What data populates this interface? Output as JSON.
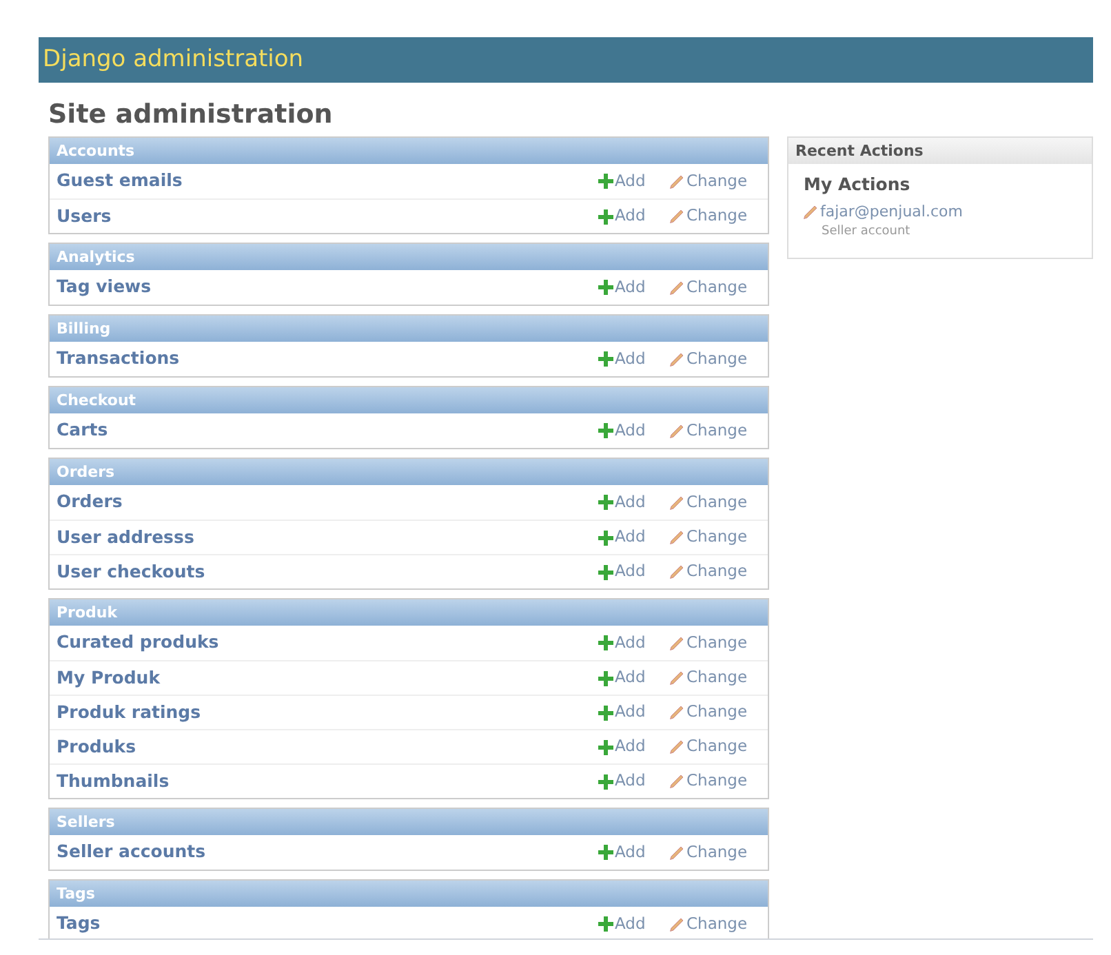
{
  "header": {
    "title": "Django administration"
  },
  "heading": "Site administration",
  "modules": [
    {
      "caption": "Accounts",
      "models": [
        {
          "name": "Guest emails",
          "add": "Add",
          "change": "Change"
        },
        {
          "name": "Users",
          "add": "Add",
          "change": "Change"
        }
      ]
    },
    {
      "caption": "Analytics",
      "models": [
        {
          "name": "Tag views",
          "add": "Add",
          "change": "Change"
        }
      ]
    },
    {
      "caption": "Billing",
      "models": [
        {
          "name": "Transactions",
          "add": "Add",
          "change": "Change"
        }
      ]
    },
    {
      "caption": "Checkout",
      "models": [
        {
          "name": "Carts",
          "add": "Add",
          "change": "Change"
        }
      ]
    },
    {
      "caption": "Orders",
      "models": [
        {
          "name": "Orders",
          "add": "Add",
          "change": "Change"
        },
        {
          "name": "User addresss",
          "add": "Add",
          "change": "Change"
        },
        {
          "name": "User checkouts",
          "add": "Add",
          "change": "Change"
        }
      ]
    },
    {
      "caption": "Produk",
      "models": [
        {
          "name": "Curated produks",
          "add": "Add",
          "change": "Change"
        },
        {
          "name": "My Produk",
          "add": "Add",
          "change": "Change"
        },
        {
          "name": "Produk ratings",
          "add": "Add",
          "change": "Change"
        },
        {
          "name": "Produks",
          "add": "Add",
          "change": "Change"
        },
        {
          "name": "Thumbnails",
          "add": "Add",
          "change": "Change"
        }
      ]
    },
    {
      "caption": "Sellers",
      "models": [
        {
          "name": "Seller accounts",
          "add": "Add",
          "change": "Change"
        }
      ]
    },
    {
      "caption": "Tags",
      "models": [
        {
          "name": "Tags",
          "add": "Add",
          "change": "Change"
        }
      ]
    }
  ],
  "recent_actions": {
    "caption": "Recent Actions",
    "title": "My Actions",
    "items": [
      {
        "kind": "change",
        "label": "fajar@penjual.com",
        "type": "Seller account"
      }
    ]
  }
}
